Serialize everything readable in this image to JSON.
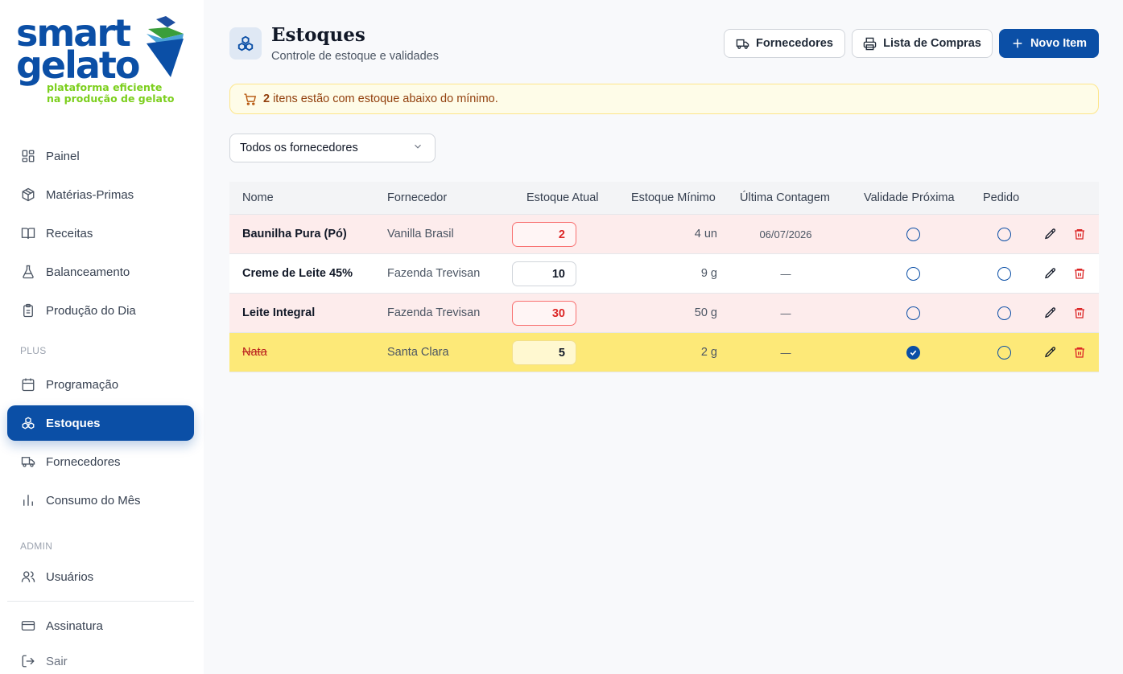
{
  "brand": {
    "line1": "smart",
    "line2": "gelato",
    "tagline1": "plataforma eficiente",
    "tagline2": "na produção de gelato"
  },
  "sidebar": {
    "items": [
      {
        "label": "Painel",
        "icon": "dashboard-icon"
      },
      {
        "label": "Matérias-Primas",
        "icon": "box-icon"
      },
      {
        "label": "Receitas",
        "icon": "book-icon"
      },
      {
        "label": "Balanceamento",
        "icon": "flask-icon"
      },
      {
        "label": "Produção do Dia",
        "icon": "clipboard-icon"
      }
    ],
    "plus_label": "PLUS",
    "plus_items": [
      {
        "label": "Programação",
        "icon": "calendar-icon"
      },
      {
        "label": "Estoques",
        "icon": "boxes-icon",
        "active": true
      },
      {
        "label": "Fornecedores",
        "icon": "truck-icon"
      },
      {
        "label": "Consumo do Mês",
        "icon": "bar-chart-icon"
      }
    ],
    "admin_label": "ADMIN",
    "admin_items": [
      {
        "label": "Usuários",
        "icon": "users-icon"
      }
    ],
    "footer_items": [
      {
        "label": "Assinatura",
        "icon": "credit-card-icon"
      },
      {
        "label": "Sair",
        "icon": "logout-icon"
      }
    ]
  },
  "header": {
    "title": "Estoques",
    "subtitle": "Controle de estoque e validades",
    "buttons": {
      "suppliers": "Fornecedores",
      "shopping_list": "Lista de Compras",
      "new_item": "Novo Item"
    }
  },
  "alert": {
    "count": "2",
    "text": "itens estão com estoque abaixo do mínimo."
  },
  "filter": {
    "selected": "Todos os fornecedores"
  },
  "table": {
    "columns": {
      "name": "Nome",
      "supplier": "Fornecedor",
      "current_stock": "Estoque Atual",
      "min_stock": "Estoque Mínimo",
      "last_count": "Última Contagem",
      "near_expiry": "Validade Próxima",
      "order": "Pedido"
    },
    "rows": [
      {
        "name": "Baunilha Pura (Pó)",
        "supplier": "Vanilla Brasil",
        "current": "2",
        "min": "4 un",
        "last_count": "06/07/2026",
        "near_expiry": false,
        "ordered": false,
        "status": "low"
      },
      {
        "name": "Creme de Leite 45%",
        "supplier": "Fazenda Trevisan",
        "current": "10",
        "min": "9 g",
        "last_count": "—",
        "near_expiry": false,
        "ordered": false,
        "status": "normal"
      },
      {
        "name": "Leite Integral",
        "supplier": "Fazenda Trevisan",
        "current": "30",
        "min": "50 g",
        "last_count": "—",
        "near_expiry": false,
        "ordered": false,
        "status": "low"
      },
      {
        "name": "Nata",
        "supplier": "Santa Clara",
        "current": "5",
        "min": "2 g",
        "last_count": "—",
        "near_expiry": true,
        "ordered": false,
        "status": "highlight"
      }
    ]
  },
  "colors": {
    "primary": "#0b4fa6",
    "danger": "#dc2626",
    "low_row": "#fdecec",
    "highlight_row": "#fde978",
    "alert_bg": "#fefce8",
    "brand_green": "#7ccf1d"
  }
}
